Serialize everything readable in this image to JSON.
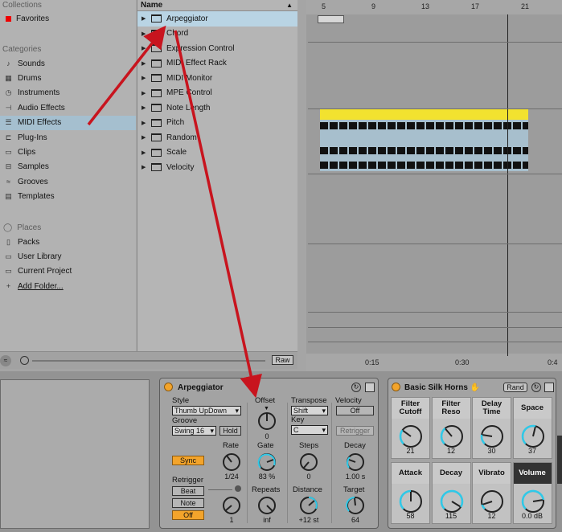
{
  "sidebar": {
    "collections_header": "Collections",
    "favorites": "Favorites",
    "categories_header": "Categories",
    "categories": [
      {
        "label": "Sounds",
        "icon": "sounds-icon",
        "glyph": "♪"
      },
      {
        "label": "Drums",
        "icon": "drums-icon",
        "glyph": "▦"
      },
      {
        "label": "Instruments",
        "icon": "instruments-icon",
        "glyph": "◷"
      },
      {
        "label": "Audio Effects",
        "icon": "audio-effects-icon",
        "glyph": "⊣"
      },
      {
        "label": "MIDI Effects",
        "icon": "midi-effects-icon",
        "glyph": "☰"
      },
      {
        "label": "Plug-Ins",
        "icon": "plugins-icon",
        "glyph": "⊏"
      },
      {
        "label": "Clips",
        "icon": "clips-icon",
        "glyph": "▭"
      },
      {
        "label": "Samples",
        "icon": "samples-icon",
        "glyph": "⊟"
      },
      {
        "label": "Grooves",
        "icon": "grooves-icon",
        "glyph": "≈"
      },
      {
        "label": "Templates",
        "icon": "templates-icon",
        "glyph": "▤"
      }
    ],
    "places_header": "Places",
    "places": [
      {
        "label": "Packs",
        "icon": "packs-icon",
        "glyph": "▯"
      },
      {
        "label": "User Library",
        "icon": "user-library-icon",
        "glyph": "▭"
      },
      {
        "label": "Current Project",
        "icon": "current-project-icon",
        "glyph": "▭"
      },
      {
        "label": "Add Folder...",
        "icon": "add-folder-icon",
        "glyph": "+"
      }
    ]
  },
  "browser": {
    "column_header": "Name",
    "items": [
      "Arpeggiator",
      "Chord",
      "Expression Control",
      "MIDI Effect Rack",
      "MIDI Monitor",
      "MPE Control",
      "Note Length",
      "Pitch",
      "Random",
      "Scale",
      "Velocity"
    ],
    "raw_label": "Raw"
  },
  "arrangement": {
    "bar_labels": [
      "5",
      "9",
      "13",
      "17",
      "21"
    ],
    "time_labels": [
      "0:15",
      "0:30",
      "0:4"
    ]
  },
  "arpeggiator": {
    "title": "Arpeggiator",
    "style_label": "Style",
    "style_value": "Thumb UpDown",
    "groove_label": "Groove",
    "groove_value": "Swing 16",
    "hold_label": "Hold",
    "offset_label": "Offset",
    "offset_value": "0",
    "transpose_label": "Transpose",
    "transpose_value": "Shift",
    "key_label": "Key",
    "key_value": "C",
    "velocity_label": "Velocity",
    "velocity_value": "Off",
    "retrigger_btn": "Retrigger",
    "sync_label": "Sync",
    "rate_label": "Rate",
    "rate_value": "1/24",
    "gate_label": "Gate",
    "gate_value": "83 %",
    "steps_label": "Steps",
    "steps_value": "0",
    "decay_label": "Decay",
    "decay_value": "1.00 s",
    "retrigger_label": "Retrigger",
    "beat_label": "Beat",
    "note_label": "Note",
    "off_label": "Off",
    "knob1_value": "1",
    "repeats_label": "Repeats",
    "repeats_value": "inf",
    "distance_label": "Distance",
    "distance_value": "+12 st",
    "target_label": "Target",
    "target_value": "64"
  },
  "silk_horns": {
    "title": "Basic Silk Horns",
    "rand_label": "Rand",
    "macros": [
      {
        "label": "Filter Cutoff",
        "value": "21"
      },
      {
        "label": "Filter Reso",
        "value": "12"
      },
      {
        "label": "Delay Time",
        "value": "30"
      },
      {
        "label": "Space",
        "value": "37"
      },
      {
        "label": "Attack",
        "value": "58"
      },
      {
        "label": "Decay",
        "value": "115"
      },
      {
        "label": "Vibrato",
        "value": "12"
      },
      {
        "label": "Volume",
        "value": "0.0 dB"
      }
    ]
  },
  "colors": {
    "accent": "#f3a42b",
    "selection": "#b9d4e4",
    "clip": "#f2e22f",
    "annotation": "#c8141e"
  }
}
